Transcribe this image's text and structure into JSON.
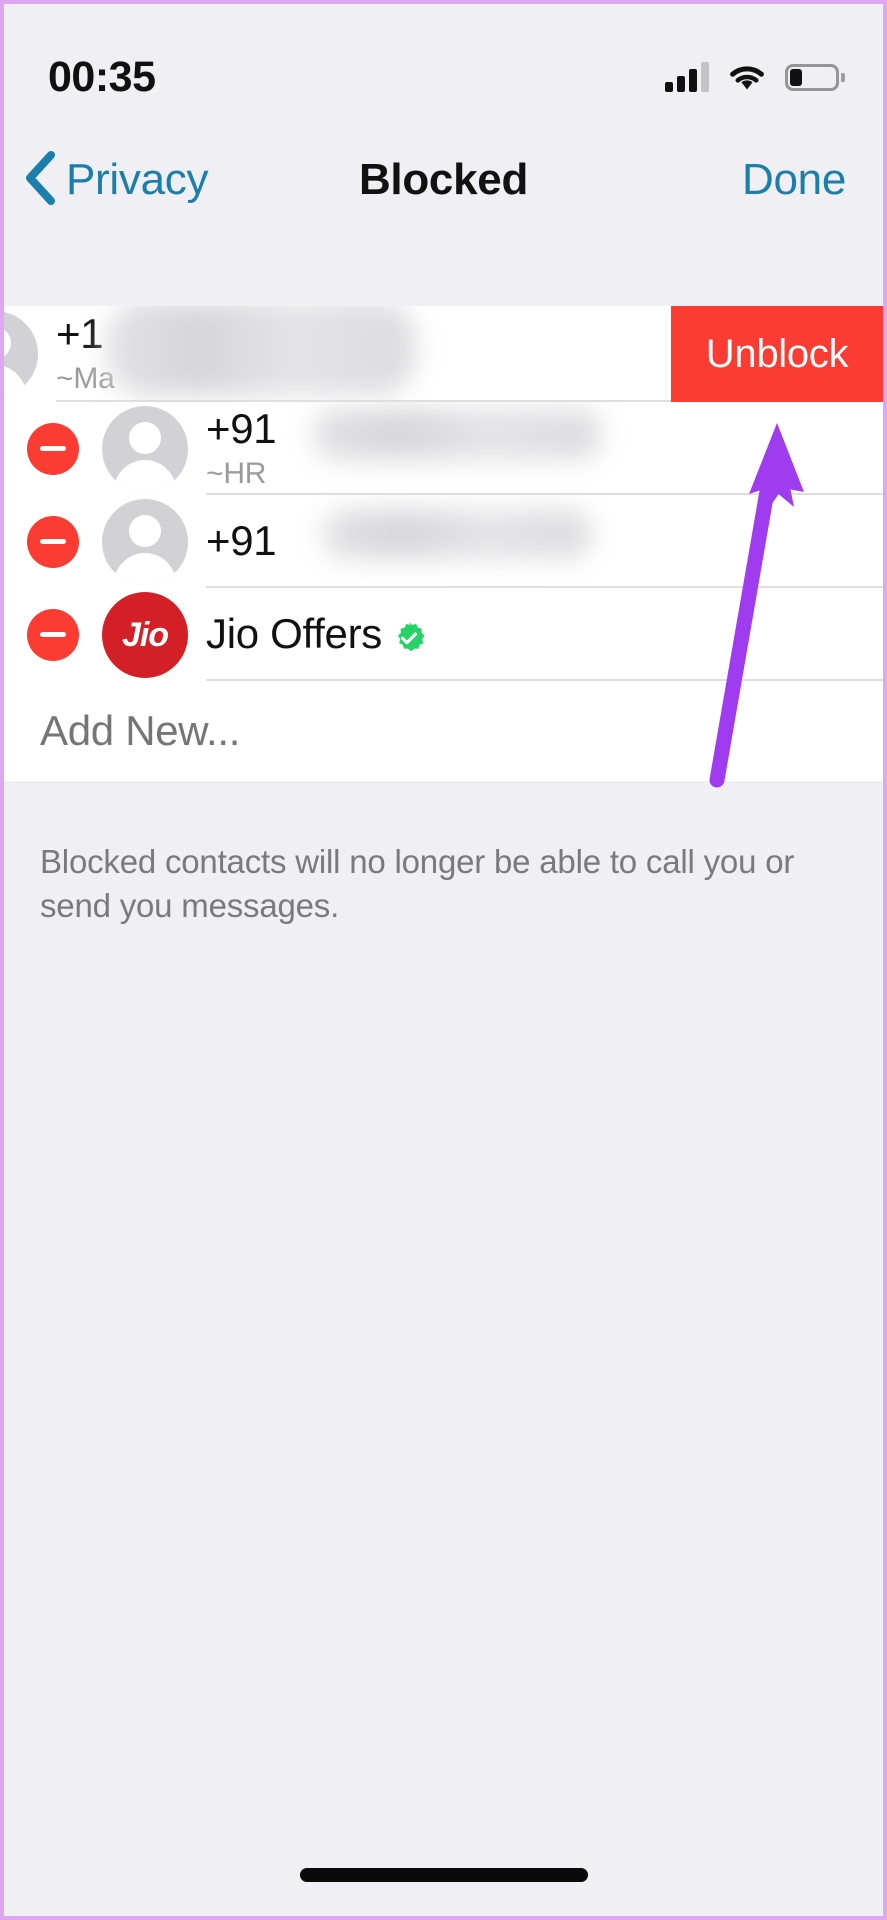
{
  "status_bar": {
    "time": "00:35",
    "cellular_icon": "cellular-bars-icon",
    "wifi_icon": "wifi-icon",
    "battery_icon": "battery-low-icon"
  },
  "nav": {
    "back_label": "Privacy",
    "back_icon": "chevron-left-icon",
    "title": "Blocked",
    "done_label": "Done"
  },
  "colors": {
    "accent_blue": "#1b7eab",
    "destructive_red": "#fa3c32",
    "jio_red": "#d31f26",
    "verified_green": "#25d366",
    "page_background": "#f0eff4",
    "annotation_purple": "#a03cf0"
  },
  "list": {
    "rows": [
      {
        "id": "row-1",
        "title_prefix": "+1",
        "subtitle_prefix": "~Ma",
        "redacted": true,
        "state": "swiped",
        "avatar": "contact-placeholder-avatar",
        "action_label": "Unblock"
      },
      {
        "id": "row-2",
        "title_prefix": "+91",
        "subtitle_prefix": "~HR",
        "redacted": true,
        "state": "edit",
        "avatar": "contact-placeholder-avatar",
        "delete_icon": "minus-circle-icon"
      },
      {
        "id": "row-3",
        "title_prefix": "+91",
        "subtitle_prefix": "",
        "redacted": true,
        "state": "edit",
        "avatar": "contact-placeholder-avatar",
        "delete_icon": "minus-circle-icon"
      },
      {
        "id": "row-4",
        "title_prefix": "Jio Offers",
        "subtitle_prefix": "",
        "redacted": false,
        "state": "edit",
        "avatar": "jio-logo-avatar",
        "avatar_text": "Jio",
        "badge_icon": "verified-business-badge-icon",
        "delete_icon": "minus-circle-icon"
      }
    ]
  },
  "add_new": {
    "placeholder": "Add New...",
    "value": ""
  },
  "footer": {
    "note": "Blocked contacts will no longer be able to call you or send you messages."
  },
  "annotation": {
    "type": "arrow",
    "points_to": "Unblock",
    "color": "#a03cf0"
  },
  "home_indicator": {
    "name": "home-indicator"
  }
}
